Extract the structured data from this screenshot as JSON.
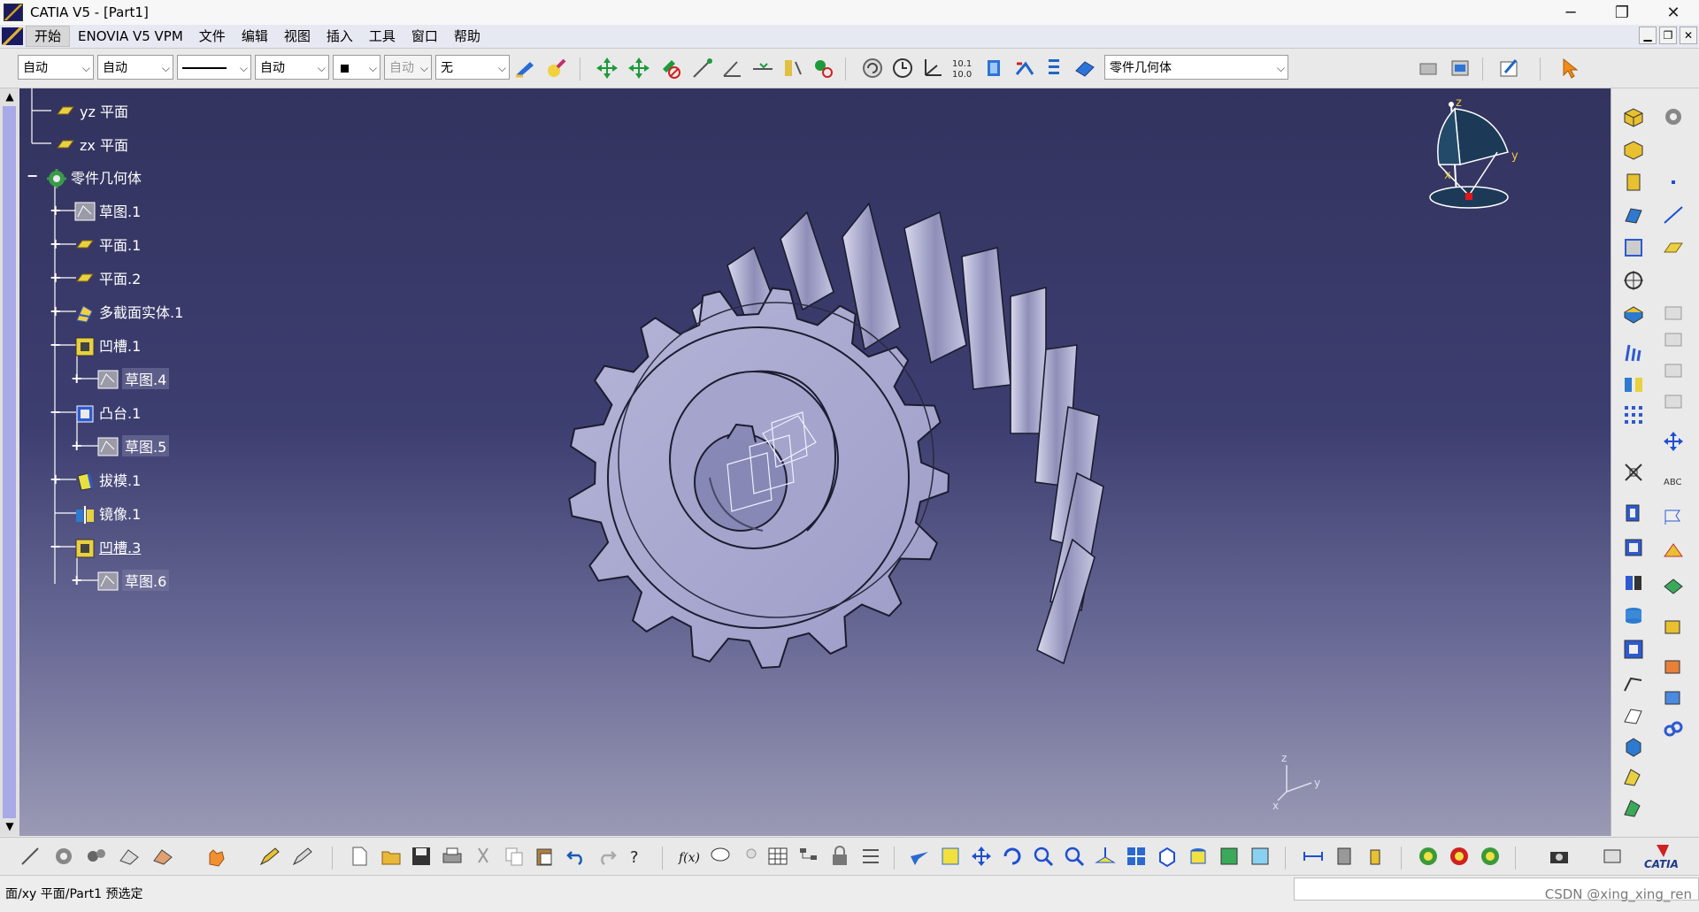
{
  "window": {
    "title": "CATIA V5 - [Part1]",
    "minimize": "─",
    "restore": "❐",
    "close": "✕"
  },
  "menu": {
    "items": [
      "开始",
      "ENOVIA V5 VPM",
      "文件",
      "编辑",
      "视图",
      "插入",
      "工具",
      "窗口",
      "帮助"
    ]
  },
  "toolbar_top": {
    "select_color": "自动",
    "select_transparency": "自动",
    "select_thickness": "自动",
    "select_layer_disabled": "自动",
    "select_none": "无",
    "current_body": "零件几何体"
  },
  "tree": {
    "items": [
      {
        "label": "yz 平面",
        "icon": "plane-icon"
      },
      {
        "label": "zx 平面",
        "icon": "plane-icon"
      },
      {
        "label": "零件几何体",
        "icon": "part-body-icon"
      },
      {
        "label": "草图.1",
        "icon": "sketch-icon"
      },
      {
        "label": "平面.1",
        "icon": "plane-icon"
      },
      {
        "label": "平面.2",
        "icon": "plane-icon"
      },
      {
        "label": "多截面实体.1",
        "icon": "multi-section-solid-icon"
      },
      {
        "label": "凹槽.1",
        "icon": "pocket-icon"
      },
      {
        "label": "草图.4",
        "icon": "sketch-icon"
      },
      {
        "label": "凸台.1",
        "icon": "pad-icon"
      },
      {
        "label": "草图.5",
        "icon": "sketch-icon"
      },
      {
        "label": "拔模.1",
        "icon": "draft-icon"
      },
      {
        "label": "镜像.1",
        "icon": "mirror-icon"
      },
      {
        "label": "凹槽.3",
        "icon": "pocket-icon"
      },
      {
        "label": "草图.6",
        "icon": "sketch-icon"
      }
    ]
  },
  "compass": {
    "z": "z",
    "x": "x",
    "y": "y"
  },
  "axis_triad": {
    "z": "z",
    "x": "x",
    "y": "y"
  },
  "brand": {
    "catia": "CATIA"
  },
  "status": {
    "text": "面/xy 平面/Part1 预选定",
    "watermark": "CSDN @xing_xing_ren"
  },
  "colors": {
    "viewport_top": "#33335f",
    "viewport_bottom": "#9a9ab5",
    "gear": "#a6a6cf",
    "tree_text": "#ffffff"
  }
}
